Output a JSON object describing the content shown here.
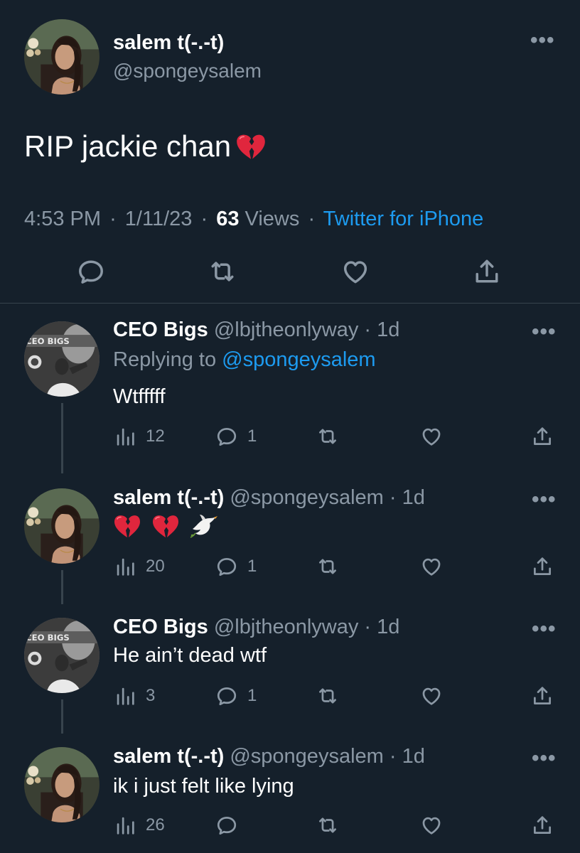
{
  "main_tweet": {
    "author_name": "salem t(-.-t)",
    "author_handle": "@spongeysalem",
    "text": "RIP jackie chan",
    "text_emoji": "broken-heart",
    "time": "4:53 PM",
    "date": "1/11/23",
    "views_count": "63",
    "views_label": "Views",
    "source": "Twitter for iPhone",
    "separator": "·"
  },
  "replies": [
    {
      "author_name": "CEO Bigs",
      "author_handle": "@lbjtheonlyway",
      "time": "· 1d",
      "replying_prefix": "Replying to",
      "replying_to": "@spongeysalem",
      "text": "Wtfffff",
      "views": "12",
      "replies": "1"
    },
    {
      "author_name": "salem t(-.-t)",
      "author_handle": "@spongeysalem",
      "time": "· 1d",
      "text_emojis": [
        "broken-heart",
        "broken-heart",
        "dove"
      ],
      "views": "20",
      "replies": "1"
    },
    {
      "author_name": "CEO Bigs",
      "author_handle": "@lbjtheonlyway",
      "time": "· 1d",
      "text": "He ain’t dead wtf",
      "views": "3",
      "replies": "1"
    },
    {
      "author_name": "salem t(-.-t)",
      "author_handle": "@spongeysalem",
      "time": "· 1d",
      "text": "ik i just felt like lying",
      "views": "26",
      "replies": ""
    }
  ],
  "icons": [
    "reply-icon",
    "retweet-icon",
    "like-icon",
    "share-icon",
    "views-icon",
    "more-icon",
    "broken-heart-emoji",
    "dove-emoji"
  ],
  "colors": {
    "background": "#15202b",
    "primary_text": "#ffffff",
    "secondary_text": "#8b98a5",
    "link": "#1d9bf0",
    "divider": "#38444d"
  }
}
